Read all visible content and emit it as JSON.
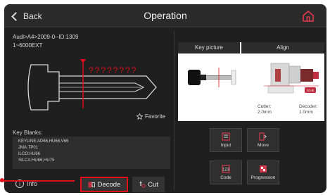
{
  "header": {
    "back_label": "Back",
    "title": "Operation"
  },
  "car": {
    "model_line": "Audi>A4>2009-0--ID:1309",
    "range_line": "1~6000EXT"
  },
  "key_diagram": {
    "unknown_cuts": "????????"
  },
  "favorite_label": "Favorite",
  "key_blanks": {
    "title": "Key Blanks:",
    "items": [
      "KEYLINE:AD66,HU66,V66",
      "JMA:TP01",
      "ILCO:HU66",
      "SILCA:HU66,HU75"
    ]
  },
  "bottom": {
    "info_label": "Info",
    "decode_label": "Decode",
    "cut_label": "Cut"
  },
  "panel": {
    "key_picture_header": "Key picture",
    "align_header": "Align",
    "cutter_label": "Cutter:",
    "cutter_value": "2.0mm",
    "decoder_label": "Decoder:",
    "decoder_value": "1.0mm",
    "align_badge": "S1-B"
  },
  "tiles": {
    "input": "Input",
    "move": "Move",
    "code": "Code",
    "progression": "Progression"
  },
  "colors": {
    "highlight": "#e0101c",
    "accent": "#d12a3a",
    "home_icon": "#e23a4a"
  }
}
